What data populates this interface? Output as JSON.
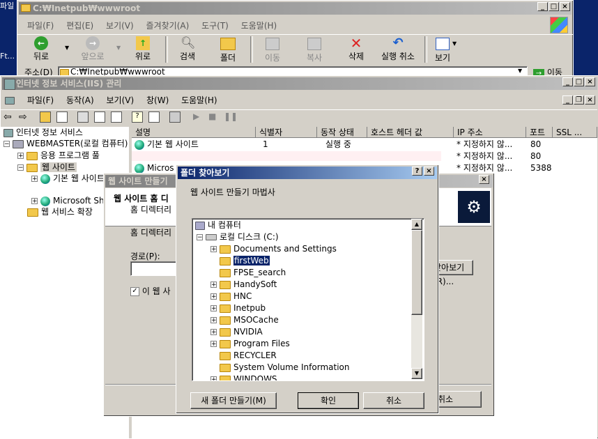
{
  "desktop": {
    "corner_text_1": "파일",
    "corner_text_2": "Ft..."
  },
  "explorer": {
    "title": "C:₩Inetpub₩wwwroot",
    "menu": [
      "파일(F)",
      "편집(E)",
      "보기(V)",
      "즐겨찾기(A)",
      "도구(T)",
      "도움말(H)"
    ],
    "toolbar": {
      "back": "뒤로",
      "forward": "앞으로",
      "up": "위로",
      "search": "검색",
      "folders": "폴더",
      "move": "이동",
      "copy": "복사",
      "delete": "삭제",
      "undo": "실행 취소",
      "view": "보기"
    },
    "address_label": "주소(D)",
    "address_value": "C:₩Inetpub₩wwwroot",
    "go_label": "이동"
  },
  "iis": {
    "title": "인터넷 정보 서비스(IIS) 관리",
    "menu": [
      "파일(F)",
      "동작(A)",
      "보기(V)",
      "창(W)",
      "도움말(H)"
    ],
    "tree": [
      {
        "label": "인터넷 정보 서비스"
      },
      {
        "label": "WEBMASTER(로컬 컴퓨터)"
      },
      {
        "label": "응용 프로그램 풀"
      },
      {
        "label": "웹 사이트"
      },
      {
        "label": "기본 웹 사이트"
      },
      {
        "label": "Microsoft SharePoint"
      },
      {
        "label": "웹 서비스 확장"
      }
    ],
    "columns": [
      "설명",
      "식별자",
      "동작 상태",
      "호스트 헤더 값",
      "IP 주소",
      "포트",
      "SSL ..."
    ],
    "rows": [
      {
        "desc": "기본 웹 사이트",
        "id": "1",
        "state": "실행 중",
        "host": "",
        "ip": "* 지정하지 않...",
        "port": "80"
      },
      {
        "desc": "",
        "id": "",
        "state": "",
        "host": "",
        "ip": "* 지정하지 않...",
        "port": "80"
      },
      {
        "desc": "Micros",
        "id": "",
        "state": "",
        "host": "",
        "ip": "* 지정하지 않...",
        "port": "5388"
      }
    ]
  },
  "wizard": {
    "title": "웹 사이트 만들기",
    "header_title": "웹 사이트 홈 디",
    "header_sub": "홈 디렉터리",
    "body_label": "홈 디렉터리",
    "path_label": "경로(P):",
    "browse_label": "찾아보기(R)...",
    "checkbox_label": "이 웹 사",
    "cancel_label": "취소"
  },
  "folder_dialog": {
    "title": "폴더 찾아보기",
    "instruction": "웹 사이트 만들기 마법사",
    "tree": [
      {
        "label": "내 컴퓨터"
      },
      {
        "label": "로컬 디스크 (C:)"
      },
      {
        "label": "Documents and Settings"
      },
      {
        "label": "firstWeb"
      },
      {
        "label": "FPSE_search"
      },
      {
        "label": "HandySoft"
      },
      {
        "label": "HNC"
      },
      {
        "label": "Inetpub"
      },
      {
        "label": "MSOCache"
      },
      {
        "label": "NVIDIA"
      },
      {
        "label": "Program Files"
      },
      {
        "label": "RECYCLER"
      },
      {
        "label": "System Volume Information"
      },
      {
        "label": "WINDOWS"
      }
    ],
    "new_folder_label": "새 폴더 만들기(M)",
    "ok_label": "확인",
    "cancel_label": "취소"
  },
  "colors": {
    "active_title": "#0a246a",
    "face": "#d4d0c8",
    "selection": "#0a246a"
  }
}
